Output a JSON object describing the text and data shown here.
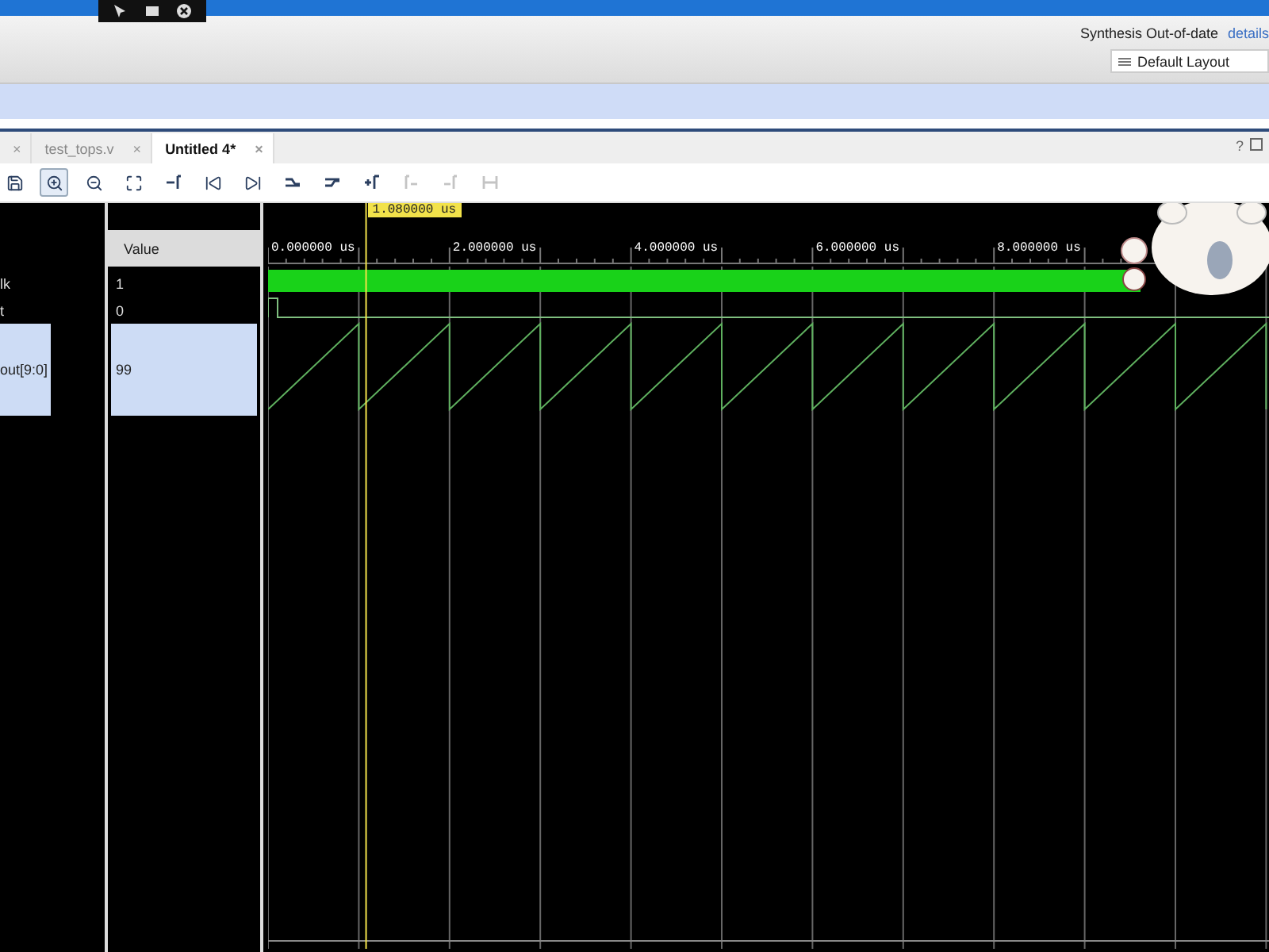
{
  "status": {
    "text": "Synthesis Out-of-date",
    "link": "details"
  },
  "layout_select": {
    "value": "Default Layout"
  },
  "tabs": [
    {
      "close": "×",
      "selected": false
    },
    {
      "label": "test_tops.v",
      "close": "×",
      "selected": false
    },
    {
      "label": "Untitled 4*",
      "close": "×",
      "selected": true
    }
  ],
  "help": "?",
  "toolbar": [
    {
      "kind": "save",
      "disabled": false,
      "selected": false
    },
    {
      "kind": "zoom-in",
      "disabled": false,
      "selected": true
    },
    {
      "kind": "zoom-out",
      "disabled": false,
      "selected": false
    },
    {
      "kind": "zoom-fit",
      "disabled": false,
      "selected": false
    },
    {
      "kind": "cursor-center",
      "disabled": false,
      "selected": false
    },
    {
      "kind": "go-start",
      "disabled": false,
      "selected": false
    },
    {
      "kind": "go-end",
      "disabled": false,
      "selected": false
    },
    {
      "kind": "prev-transition",
      "disabled": false,
      "selected": false
    },
    {
      "kind": "next-transition",
      "disabled": false,
      "selected": false
    },
    {
      "kind": "add-marker",
      "disabled": false,
      "selected": false
    },
    {
      "kind": "prev-marker",
      "disabled": true,
      "selected": false
    },
    {
      "kind": "next-marker",
      "disabled": true,
      "selected": false
    },
    {
      "kind": "swap-markers",
      "disabled": true,
      "selected": false
    }
  ],
  "columns": {
    "value": "Value"
  },
  "cursor": "1.080000 us",
  "ruler": [
    "0.000000 us",
    "2.000000 us",
    "4.000000 us",
    "6.000000 us",
    "8.000000 us"
  ],
  "signals": [
    {
      "name": "lk",
      "value": "1",
      "kind": "clock",
      "selected": false
    },
    {
      "name": "t",
      "value": "0",
      "kind": "bit",
      "selected": false
    },
    {
      "name": "out[9:0]",
      "value": "99",
      "kind": "bus",
      "selected": true
    }
  ]
}
